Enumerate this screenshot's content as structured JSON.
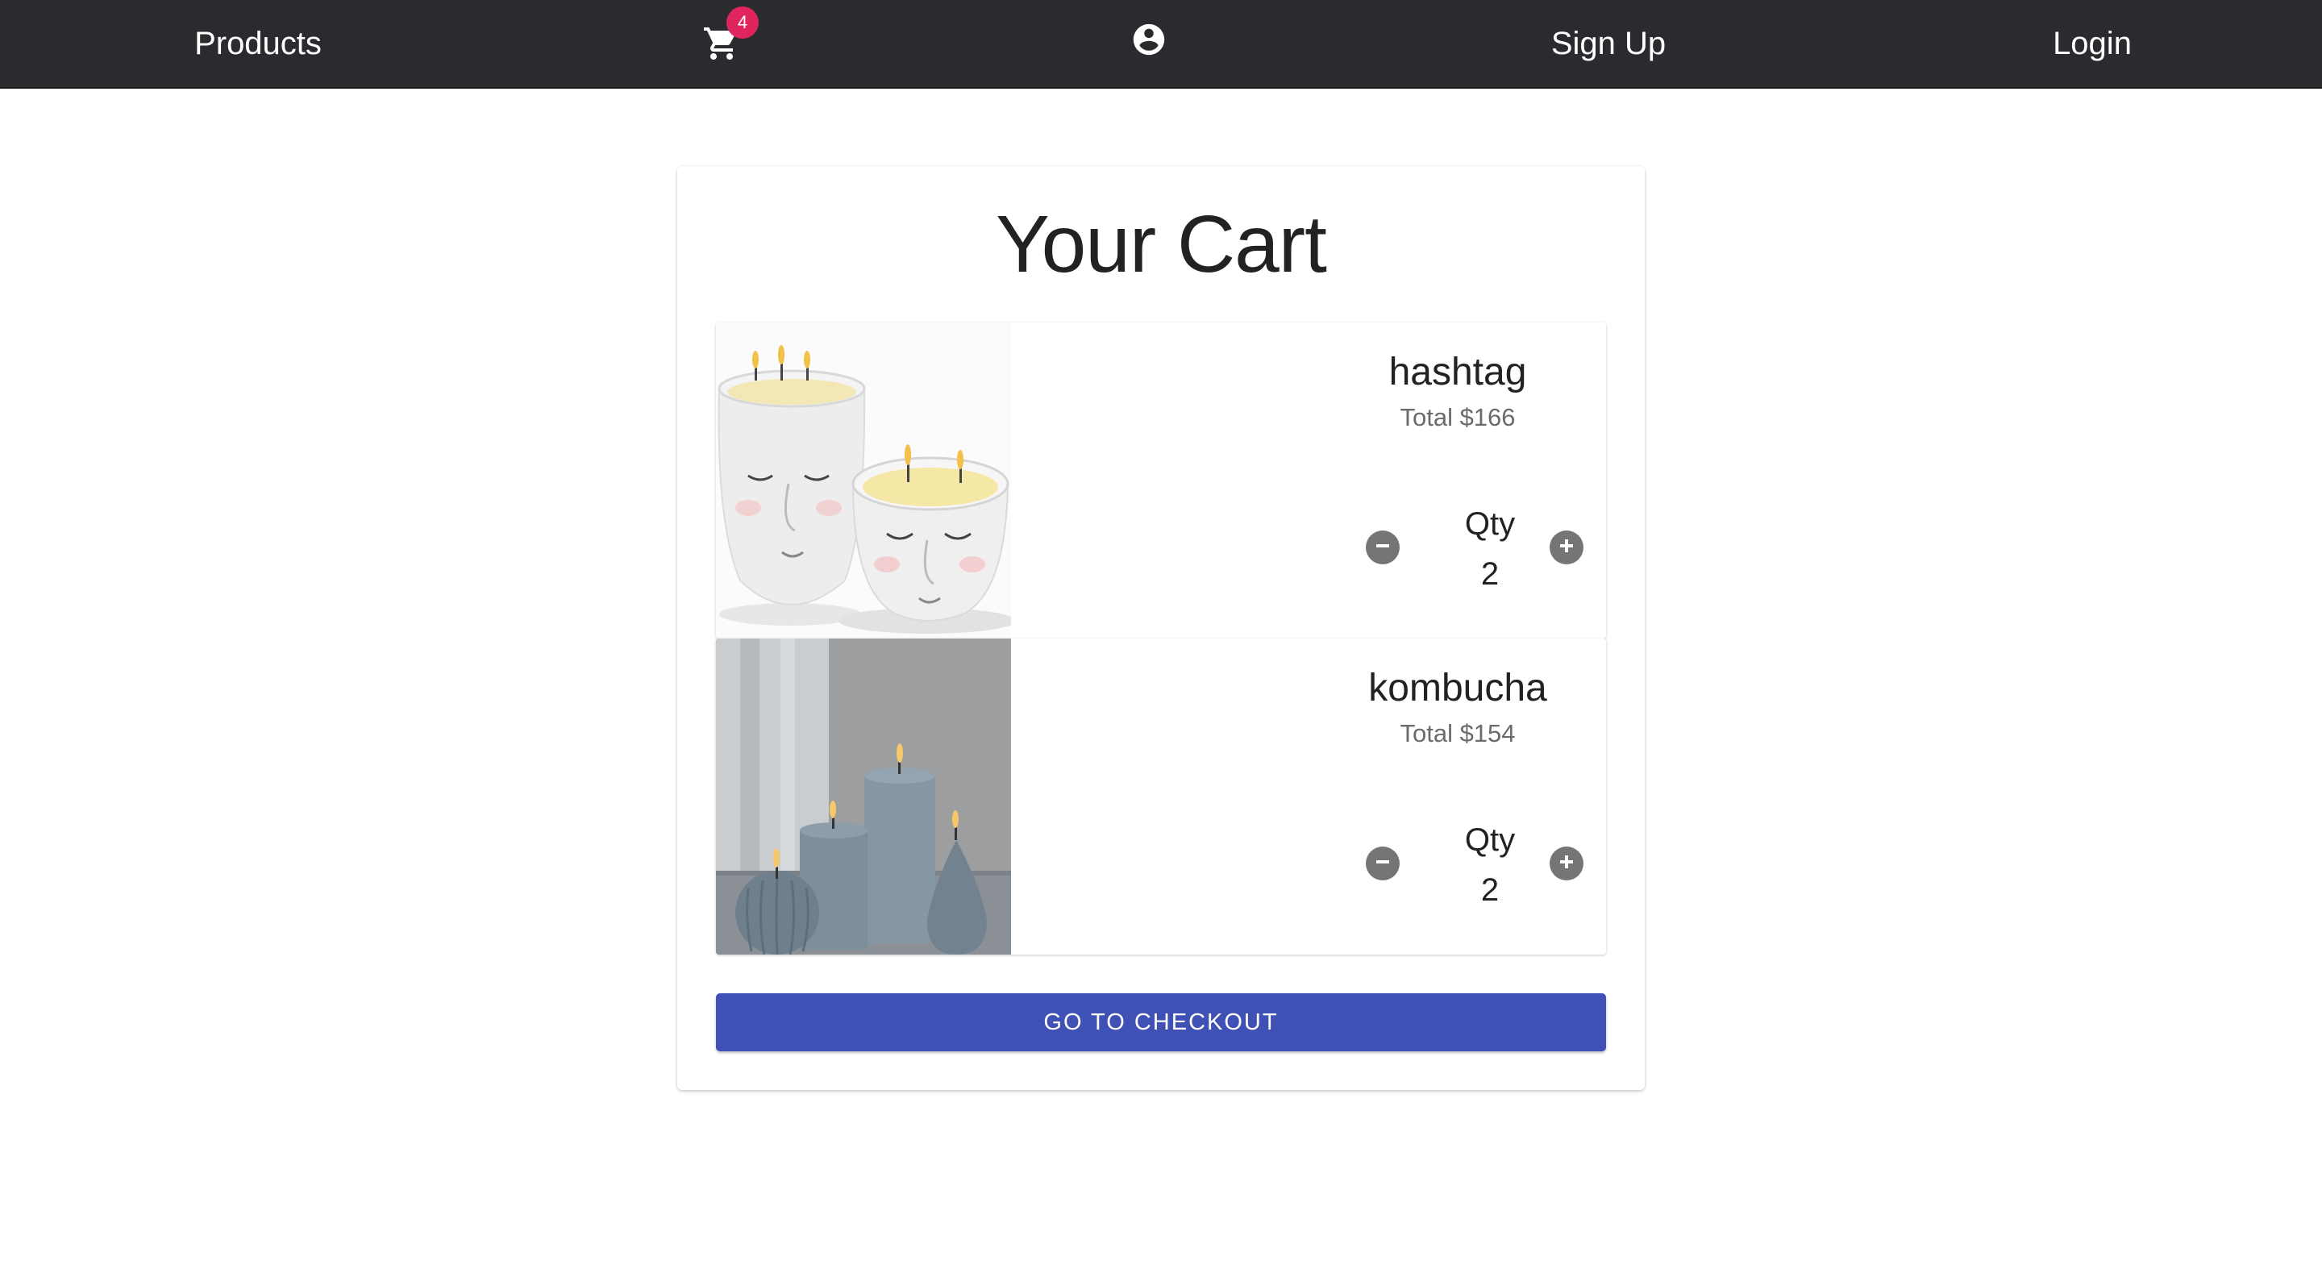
{
  "nav": {
    "products_label": "Products",
    "cart_icon": "cart-icon",
    "cart_badge_count": "4",
    "account_icon": "account-circle-icon",
    "signup_label": "Sign Up",
    "login_label": "Login"
  },
  "cart": {
    "title": "Your Cart",
    "items": [
      {
        "name": "hashtag",
        "total": "Total $166",
        "qty_label": "Qty",
        "qty": "2",
        "image": "white-face-candles-image"
      },
      {
        "name": "kombucha",
        "total": "Total $154",
        "qty_label": "Qty",
        "qty": "2",
        "image": "grey-pillar-candles-image"
      }
    ],
    "checkout_label": "GO TO CHECKOUT"
  },
  "colors": {
    "navbar": "#2a2b2e",
    "badge": "#e0245e",
    "checkout": "#3f51b5",
    "qty_button": "#757575"
  }
}
